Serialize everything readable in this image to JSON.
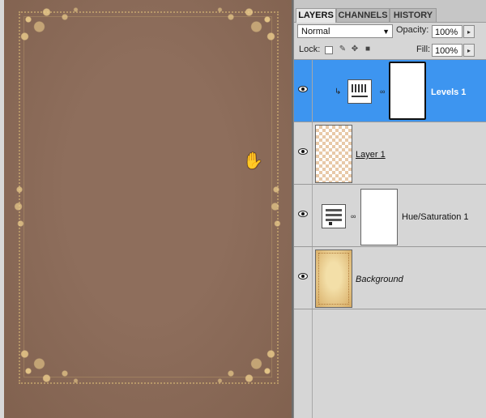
{
  "panel": {
    "tabs": [
      {
        "label": "LAYERS",
        "active": true
      },
      {
        "label": "CHANNELS",
        "active": false
      },
      {
        "label": "HISTORY",
        "active": false
      }
    ],
    "blend_mode": "Normal",
    "opacity_label": "Opacity:",
    "opacity_value": "100%",
    "lock_label": "Lock:",
    "fill_label": "Fill:",
    "fill_value": "100%"
  },
  "layers": [
    {
      "name": "Levels 1",
      "type": "adjustment-levels",
      "selected": true,
      "visible": true,
      "clipped": true
    },
    {
      "name": "Layer 1",
      "type": "pixel",
      "selected": false,
      "visible": true
    },
    {
      "name": "Hue/Saturation 1",
      "type": "adjustment-hue-saturation",
      "selected": false,
      "visible": true
    },
    {
      "name": "Background",
      "type": "background",
      "selected": false,
      "visible": true
    }
  ],
  "icons": {
    "eye": "eye-icon",
    "chain": "chain-link-icon",
    "clip": "clip-arrow-icon",
    "cursor": "hand-cursor-icon"
  },
  "colors": {
    "selected_layer": "#3d95f0",
    "canvas_paper": "#8e6e5c",
    "ornament": "#ecd08c"
  }
}
